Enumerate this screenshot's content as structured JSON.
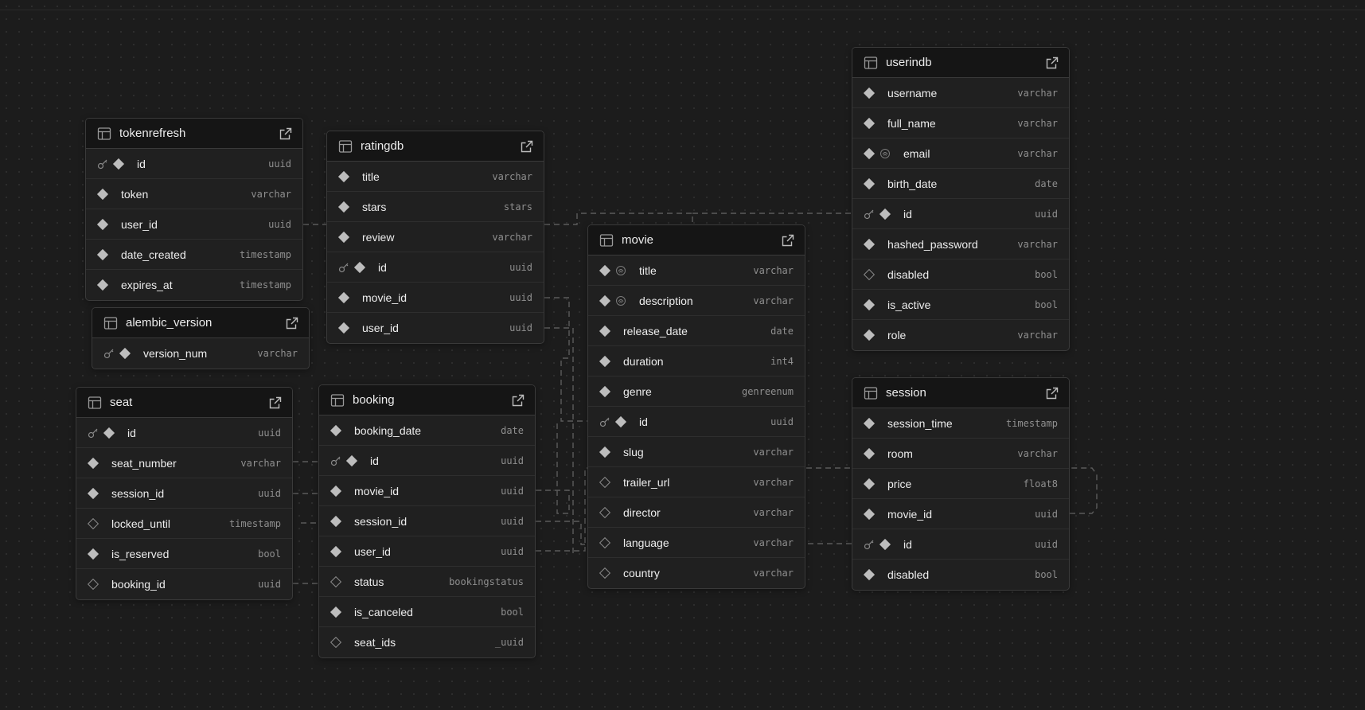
{
  "tables": [
    {
      "key": "tokenrefresh",
      "name": "tokenrefresh",
      "columns": [
        {
          "name": "id",
          "type": "uuid",
          "pk": true,
          "nullable": false
        },
        {
          "name": "token",
          "type": "varchar",
          "nullable": false
        },
        {
          "name": "user_id",
          "type": "uuid",
          "nullable": false
        },
        {
          "name": "date_created",
          "type": "timestamp",
          "nullable": false
        },
        {
          "name": "expires_at",
          "type": "timestamp",
          "nullable": false
        }
      ]
    },
    {
      "key": "alembic_version",
      "name": "alembic_version",
      "columns": [
        {
          "name": "version_num",
          "type": "varchar",
          "pk": true,
          "nullable": false
        }
      ]
    },
    {
      "key": "seat",
      "name": "seat",
      "columns": [
        {
          "name": "id",
          "type": "uuid",
          "pk": true,
          "nullable": false
        },
        {
          "name": "seat_number",
          "type": "varchar",
          "nullable": false
        },
        {
          "name": "session_id",
          "type": "uuid",
          "nullable": false
        },
        {
          "name": "locked_until",
          "type": "timestamp",
          "nullable": true
        },
        {
          "name": "is_reserved",
          "type": "bool",
          "nullable": false
        },
        {
          "name": "booking_id",
          "type": "uuid",
          "nullable": true
        }
      ]
    },
    {
      "key": "ratingdb",
      "name": "ratingdb",
      "columns": [
        {
          "name": "title",
          "type": "varchar",
          "nullable": false
        },
        {
          "name": "stars",
          "type": "stars",
          "nullable": false
        },
        {
          "name": "review",
          "type": "varchar",
          "nullable": false
        },
        {
          "name": "id",
          "type": "uuid",
          "pk": true,
          "nullable": false
        },
        {
          "name": "movie_id",
          "type": "uuid",
          "nullable": false
        },
        {
          "name": "user_id",
          "type": "uuid",
          "nullable": false
        }
      ]
    },
    {
      "key": "booking",
      "name": "booking",
      "columns": [
        {
          "name": "booking_date",
          "type": "date",
          "nullable": false
        },
        {
          "name": "id",
          "type": "uuid",
          "pk": true,
          "nullable": false
        },
        {
          "name": "movie_id",
          "type": "uuid",
          "nullable": false
        },
        {
          "name": "session_id",
          "type": "uuid",
          "nullable": false
        },
        {
          "name": "user_id",
          "type": "uuid",
          "nullable": false
        },
        {
          "name": "status",
          "type": "bookingstatus",
          "nullable": true
        },
        {
          "name": "is_canceled",
          "type": "bool",
          "nullable": false
        },
        {
          "name": "seat_ids",
          "type": "_uuid",
          "nullable": true
        }
      ]
    },
    {
      "key": "movie",
      "name": "movie",
      "columns": [
        {
          "name": "title",
          "type": "varchar",
          "nullable": false,
          "identity": true
        },
        {
          "name": "description",
          "type": "varchar",
          "nullable": false,
          "identity": true
        },
        {
          "name": "release_date",
          "type": "date",
          "nullable": false
        },
        {
          "name": "duration",
          "type": "int4",
          "nullable": false
        },
        {
          "name": "genre",
          "type": "genreenum",
          "nullable": false
        },
        {
          "name": "id",
          "type": "uuid",
          "pk": true,
          "nullable": false
        },
        {
          "name": "slug",
          "type": "varchar",
          "nullable": false
        },
        {
          "name": "trailer_url",
          "type": "varchar",
          "nullable": true
        },
        {
          "name": "director",
          "type": "varchar",
          "nullable": true
        },
        {
          "name": "language",
          "type": "varchar",
          "nullable": true
        },
        {
          "name": "country",
          "type": "varchar",
          "nullable": true
        }
      ]
    },
    {
      "key": "userindb",
      "name": "userindb",
      "columns": [
        {
          "name": "username",
          "type": "varchar",
          "nullable": false
        },
        {
          "name": "full_name",
          "type": "varchar",
          "nullable": false
        },
        {
          "name": "email",
          "type": "varchar",
          "nullable": false,
          "identity": true
        },
        {
          "name": "birth_date",
          "type": "date",
          "nullable": false
        },
        {
          "name": "id",
          "type": "uuid",
          "pk": true,
          "nullable": false
        },
        {
          "name": "hashed_password",
          "type": "varchar",
          "nullable": false
        },
        {
          "name": "disabled",
          "type": "bool",
          "nullable": true
        },
        {
          "name": "is_active",
          "type": "bool",
          "nullable": false
        },
        {
          "name": "role",
          "type": "varchar",
          "nullable": false
        }
      ]
    },
    {
      "key": "session",
      "name": "session",
      "columns": [
        {
          "name": "session_time",
          "type": "timestamp",
          "nullable": false
        },
        {
          "name": "room",
          "type": "varchar",
          "nullable": false
        },
        {
          "name": "price",
          "type": "float8",
          "nullable": false
        },
        {
          "name": "movie_id",
          "type": "uuid",
          "nullable": false
        },
        {
          "name": "id",
          "type": "uuid",
          "pk": true,
          "nullable": false
        },
        {
          "name": "disabled",
          "type": "bool",
          "nullable": false
        }
      ]
    }
  ],
  "relations": [
    {
      "from": "tokenrefresh.user_id",
      "to": "userindb.id"
    },
    {
      "from": "ratingdb.user_id",
      "to": "userindb.id"
    },
    {
      "from": "ratingdb.movie_id",
      "to": "movie.id"
    },
    {
      "from": "booking.movie_id",
      "to": "movie.id"
    },
    {
      "from": "booking.session_id",
      "to": "session.id"
    },
    {
      "from": "booking.user_id",
      "to": "userindb.id"
    },
    {
      "from": "seat.session_id",
      "to": "session.id"
    },
    {
      "from": "seat.booking_id",
      "to": "booking.id"
    },
    {
      "from": "seat.seat_number",
      "to": "booking.id"
    },
    {
      "from": "seat.locked_until",
      "to": "booking.session_id"
    },
    {
      "from": "session.movie_id",
      "to": "movie.id"
    }
  ],
  "colors": {
    "background": "#1c1c1c",
    "table": "#202020",
    "header": "#151515",
    "border": "#3a3a3a",
    "edge": "#5a5a5a"
  }
}
